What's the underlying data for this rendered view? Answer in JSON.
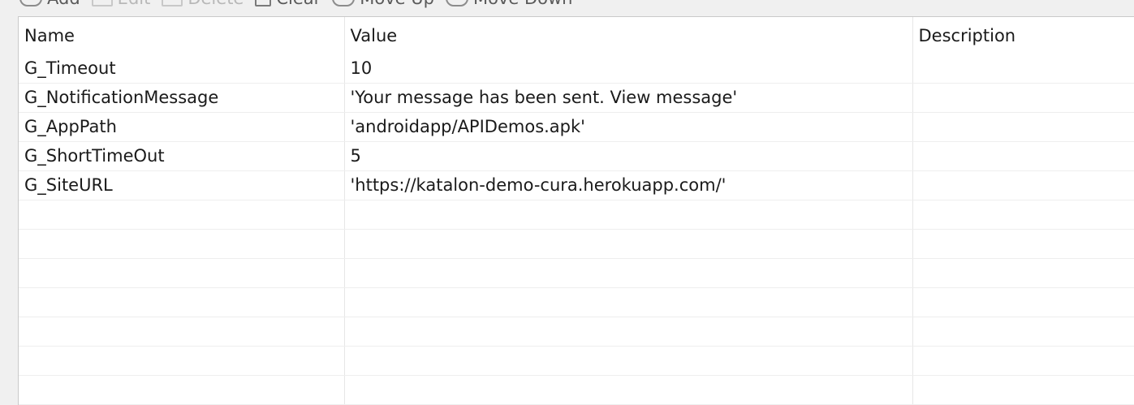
{
  "toolbar": {
    "buttons": [
      {
        "label": "Add",
        "enabled": true
      },
      {
        "label": "Edit",
        "enabled": false
      },
      {
        "label": "Delete",
        "enabled": false
      },
      {
        "label": "Clear",
        "enabled": true
      },
      {
        "label": "Move Up",
        "enabled": true
      },
      {
        "label": "Move Down",
        "enabled": true
      }
    ]
  },
  "table": {
    "columns": [
      "Name",
      "Value",
      "Description"
    ],
    "rows": [
      {
        "name": "G_Timeout",
        "value": "10",
        "description": ""
      },
      {
        "name": "G_NotificationMessage",
        "value": "'Your message has been sent. View message'",
        "description": ""
      },
      {
        "name": "G_AppPath",
        "value": "'androidapp/APIDemos.apk'",
        "description": ""
      },
      {
        "name": "G_ShortTimeOut",
        "value": "5",
        "description": ""
      },
      {
        "name": "G_SiteURL",
        "value": "'https://katalon-demo-cura.herokuapp.com/'",
        "description": ""
      },
      {
        "name": "",
        "value": "",
        "description": ""
      },
      {
        "name": "",
        "value": "",
        "description": ""
      },
      {
        "name": "",
        "value": "",
        "description": ""
      },
      {
        "name": "",
        "value": "",
        "description": ""
      },
      {
        "name": "",
        "value": "",
        "description": ""
      },
      {
        "name": "",
        "value": "",
        "description": ""
      },
      {
        "name": "",
        "value": "",
        "description": ""
      }
    ]
  },
  "colors": {
    "background": "#f0f0f0",
    "table_background": "#ffffff",
    "grid_line": "#e6e6e6",
    "text": "#1a1a1a"
  }
}
